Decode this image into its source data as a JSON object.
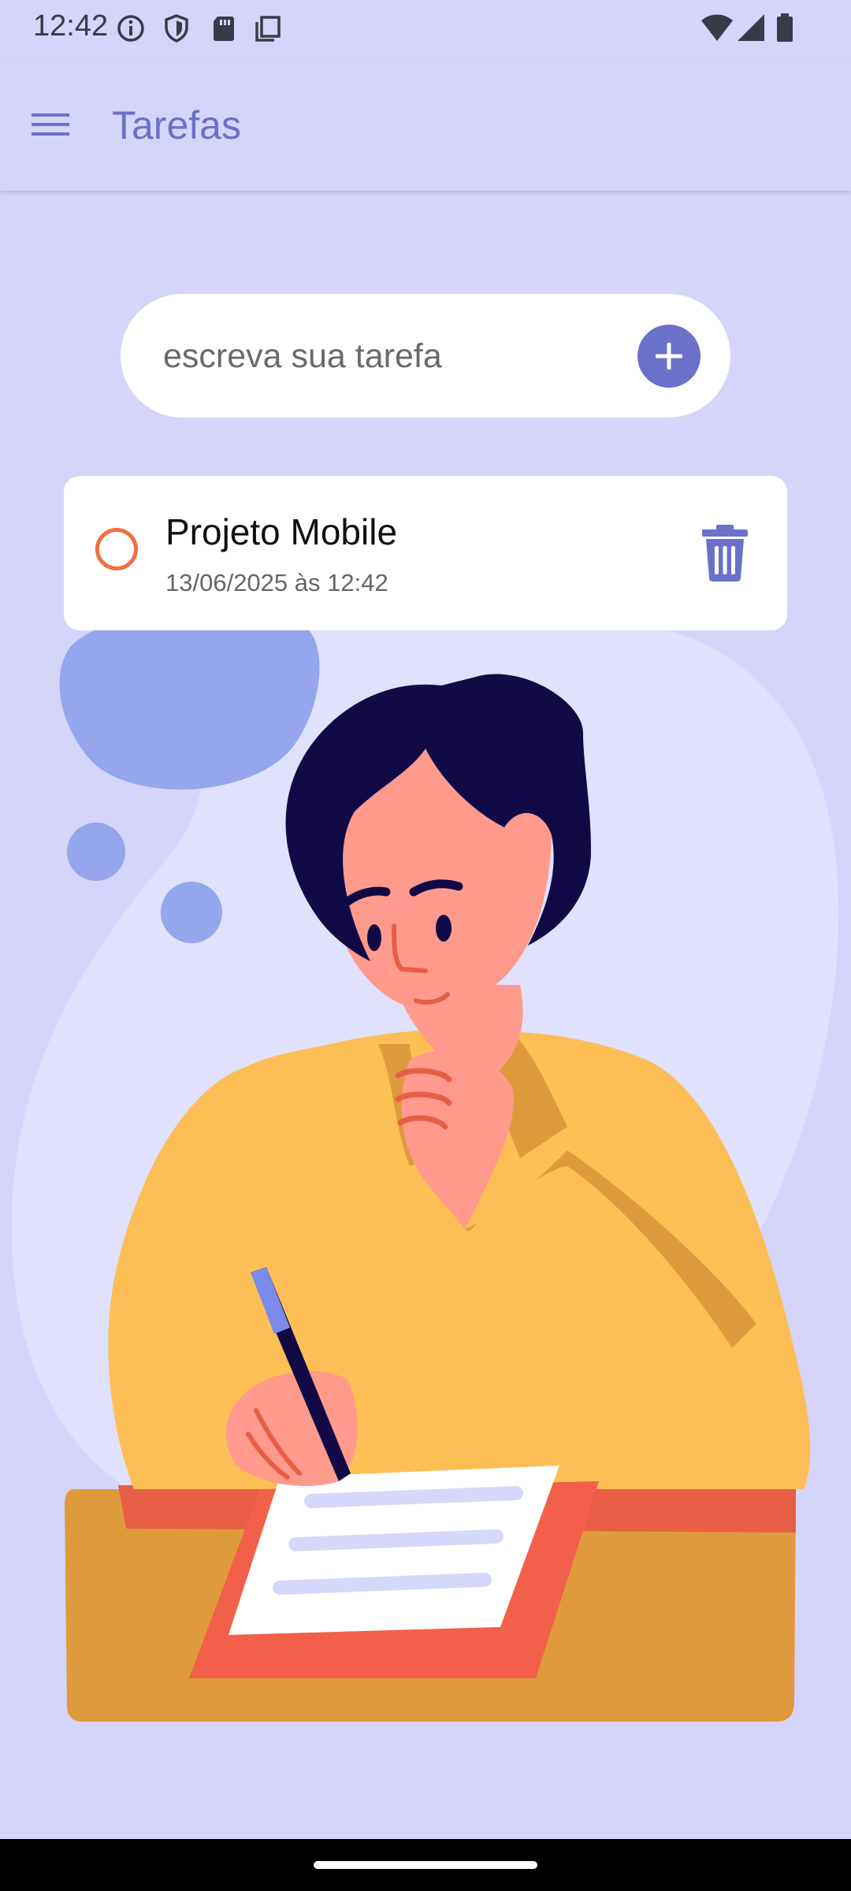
{
  "status_bar": {
    "time": "12:42",
    "icons_left": [
      "info-icon",
      "shield-icon",
      "sd-card-icon",
      "copy-icon"
    ],
    "icons_right": [
      "wifi-icon",
      "signal-icon",
      "battery-icon"
    ]
  },
  "app_bar": {
    "menu_icon": "menu-icon",
    "title": "Tarefas"
  },
  "task_input": {
    "placeholder": "escreva sua tarefa",
    "value": "",
    "add_icon": "plus-icon"
  },
  "tasks": [
    {
      "title": "Projeto Mobile",
      "date": "13/06/2025 às 12:42",
      "completed": false,
      "delete_icon": "trash-icon"
    }
  ],
  "colors": {
    "background": "#D5D5FA",
    "accent": "#6B70C9",
    "checkbox": "#F2703F"
  }
}
